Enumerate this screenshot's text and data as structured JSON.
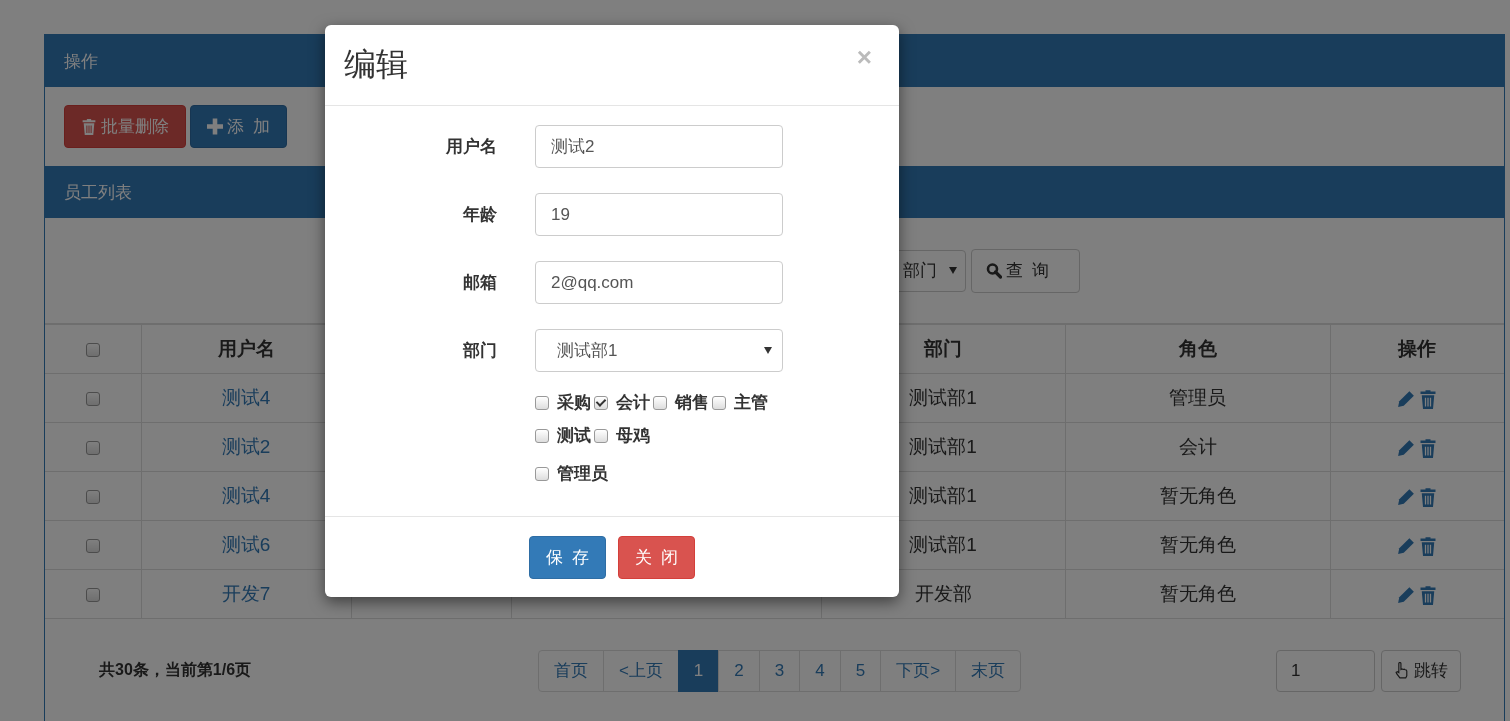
{
  "operations_panel": {
    "title": "操作",
    "buttons": [
      {
        "kind": "danger",
        "label": "批量删除"
      },
      {
        "kind": "primary",
        "label": "添  加"
      }
    ]
  },
  "list_panel": {
    "title": "员工列表",
    "filter": {
      "select_value": "部门",
      "search_button": "查  询"
    },
    "table": {
      "all_checked": false,
      "headers": {
        "username": "用户名",
        "department": "部门",
        "role": "角色",
        "actions": "操作"
      },
      "rows": [
        {
          "checked": false,
          "username": "测试4",
          "department": "测试部1",
          "role": "管理员"
        },
        {
          "checked": false,
          "username": "测试2",
          "department": "测试部1",
          "role": "会计"
        },
        {
          "checked": false,
          "username": "测试4",
          "department": "测试部1",
          "role": "暂无角色"
        },
        {
          "checked": false,
          "username": "测试6",
          "department": "测试部1",
          "role": "暂无角色"
        },
        {
          "checked": false,
          "username": "开发7",
          "department": "开发部",
          "role": "暂无角色"
        }
      ]
    },
    "pagination": {
      "summary": "共30条，当前第1/6页",
      "pages": [
        {
          "label": "首页",
          "selected": false
        },
        {
          "label": "<上页",
          "selected": false
        },
        {
          "label": "1",
          "selected": true
        },
        {
          "label": "2",
          "selected": false
        },
        {
          "label": "3",
          "selected": false
        },
        {
          "label": "4",
          "selected": false
        },
        {
          "label": "5",
          "selected": false
        },
        {
          "label": "下页>",
          "selected": false
        },
        {
          "label": "末页",
          "selected": false
        }
      ],
      "jump_value": "1",
      "jump_button": "跳转"
    }
  },
  "modal": {
    "title": "编辑",
    "close": "×",
    "fields": [
      {
        "label": "用户名",
        "kind": "text",
        "value": "测试2"
      },
      {
        "label": "年龄",
        "kind": "text",
        "value": "19"
      },
      {
        "label": "邮箱",
        "kind": "text",
        "value": "2@qq.com"
      },
      {
        "label": "部门",
        "kind": "select",
        "value": "测试部1"
      }
    ],
    "role_groups": [
      [
        {
          "label": "采购",
          "checked": false
        },
        {
          "label": "会计",
          "checked": true
        },
        {
          "label": "销售",
          "checked": false
        },
        {
          "label": "主管",
          "checked": false
        },
        {
          "label": "测试",
          "checked": false
        },
        {
          "label": "母鸡",
          "checked": false
        }
      ],
      [
        {
          "label": "管理员",
          "checked": false
        }
      ]
    ],
    "buttons": [
      {
        "kind": "primary",
        "label": "保  存"
      },
      {
        "kind": "danger",
        "label": "关  闭"
      }
    ]
  }
}
